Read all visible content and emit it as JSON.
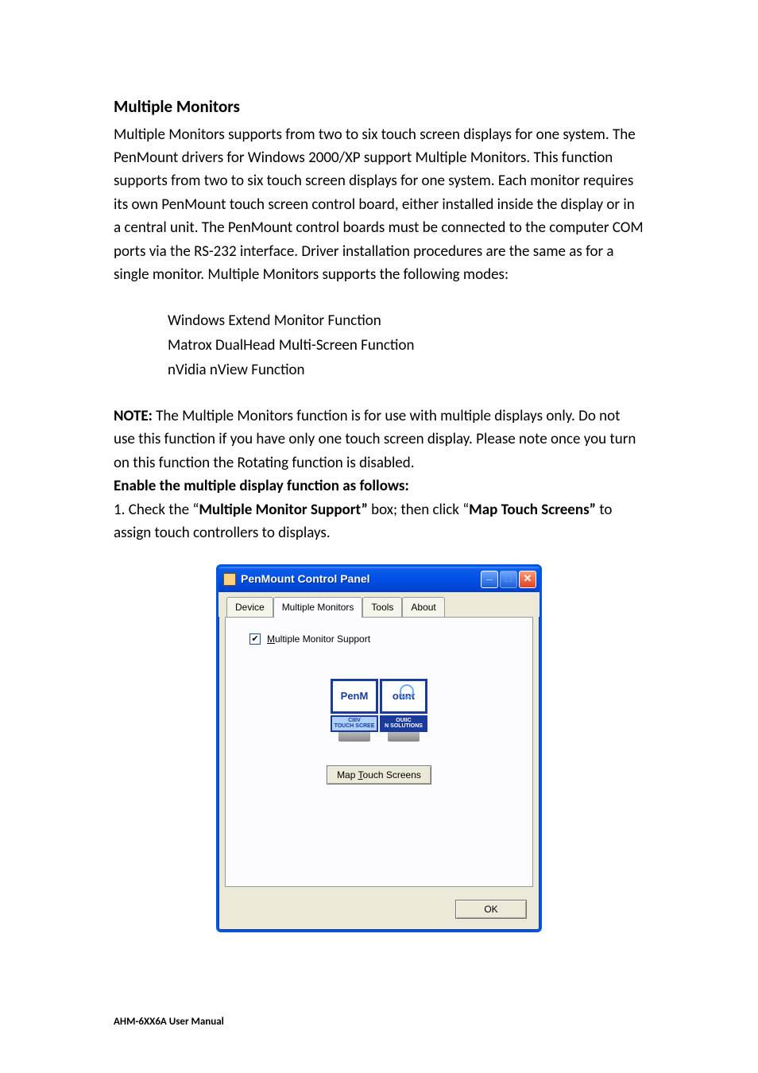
{
  "heading": "Multiple Monitors",
  "body_para": "Multiple Monitors supports from two to six touch screen displays for one system. The PenMount drivers for Windows 2000/XP support Multiple Monitors. This function supports from two to six touch screen displays for one system. Each monitor requires its own PenMount touch screen control board, either installed inside the display or in a central unit. The PenMount control boards must be connected to the computer COM ports via the RS-232 interface. Driver installation procedures are the same as for a single monitor. Multiple Monitors supports the following modes:",
  "modes": [
    "Windows Extend Monitor Function",
    "Matrox DualHead Multi-Screen Function",
    "nVidia nView Function"
  ],
  "note_label": "NOTE:",
  "note_text": " The Multiple Monitors function is for use with multiple displays only. Do not use this function if you have only one touch screen display. Please note once you turn on this function the Rotating function is disabled.",
  "enable_line": "Enable the multiple display function as follows:",
  "step1_pre": "1. Check the “",
  "step1_bold1": "Multiple Monitor Support”",
  "step1_mid": " box; then click “",
  "step1_bold2": "Map Touch Screens”",
  "step1_post": " to assign touch controllers to displays.",
  "window": {
    "title": "PenMount Control Panel",
    "tabs": [
      "Device",
      "Multiple Monitors",
      "Tools",
      "About"
    ],
    "checkbox_checked": true,
    "checkbox_prefix": "M",
    "checkbox_rest": "ultiple Monitor Support",
    "monitor_left_text": "PenM",
    "monitor_right_text": "ount",
    "cap_left_line1": "CIIIV",
    "cap_left_line2": "TOUCH SCREE",
    "cap_right_line1": "OUIIC",
    "cap_right_line2": "N SOLUTIONS",
    "map_btn_prefix": "Map ",
    "map_btn_ul": "T",
    "map_btn_rest": "ouch Screens",
    "ok_label": "OK"
  },
  "footer": "AHM-6XX6A User Manual"
}
